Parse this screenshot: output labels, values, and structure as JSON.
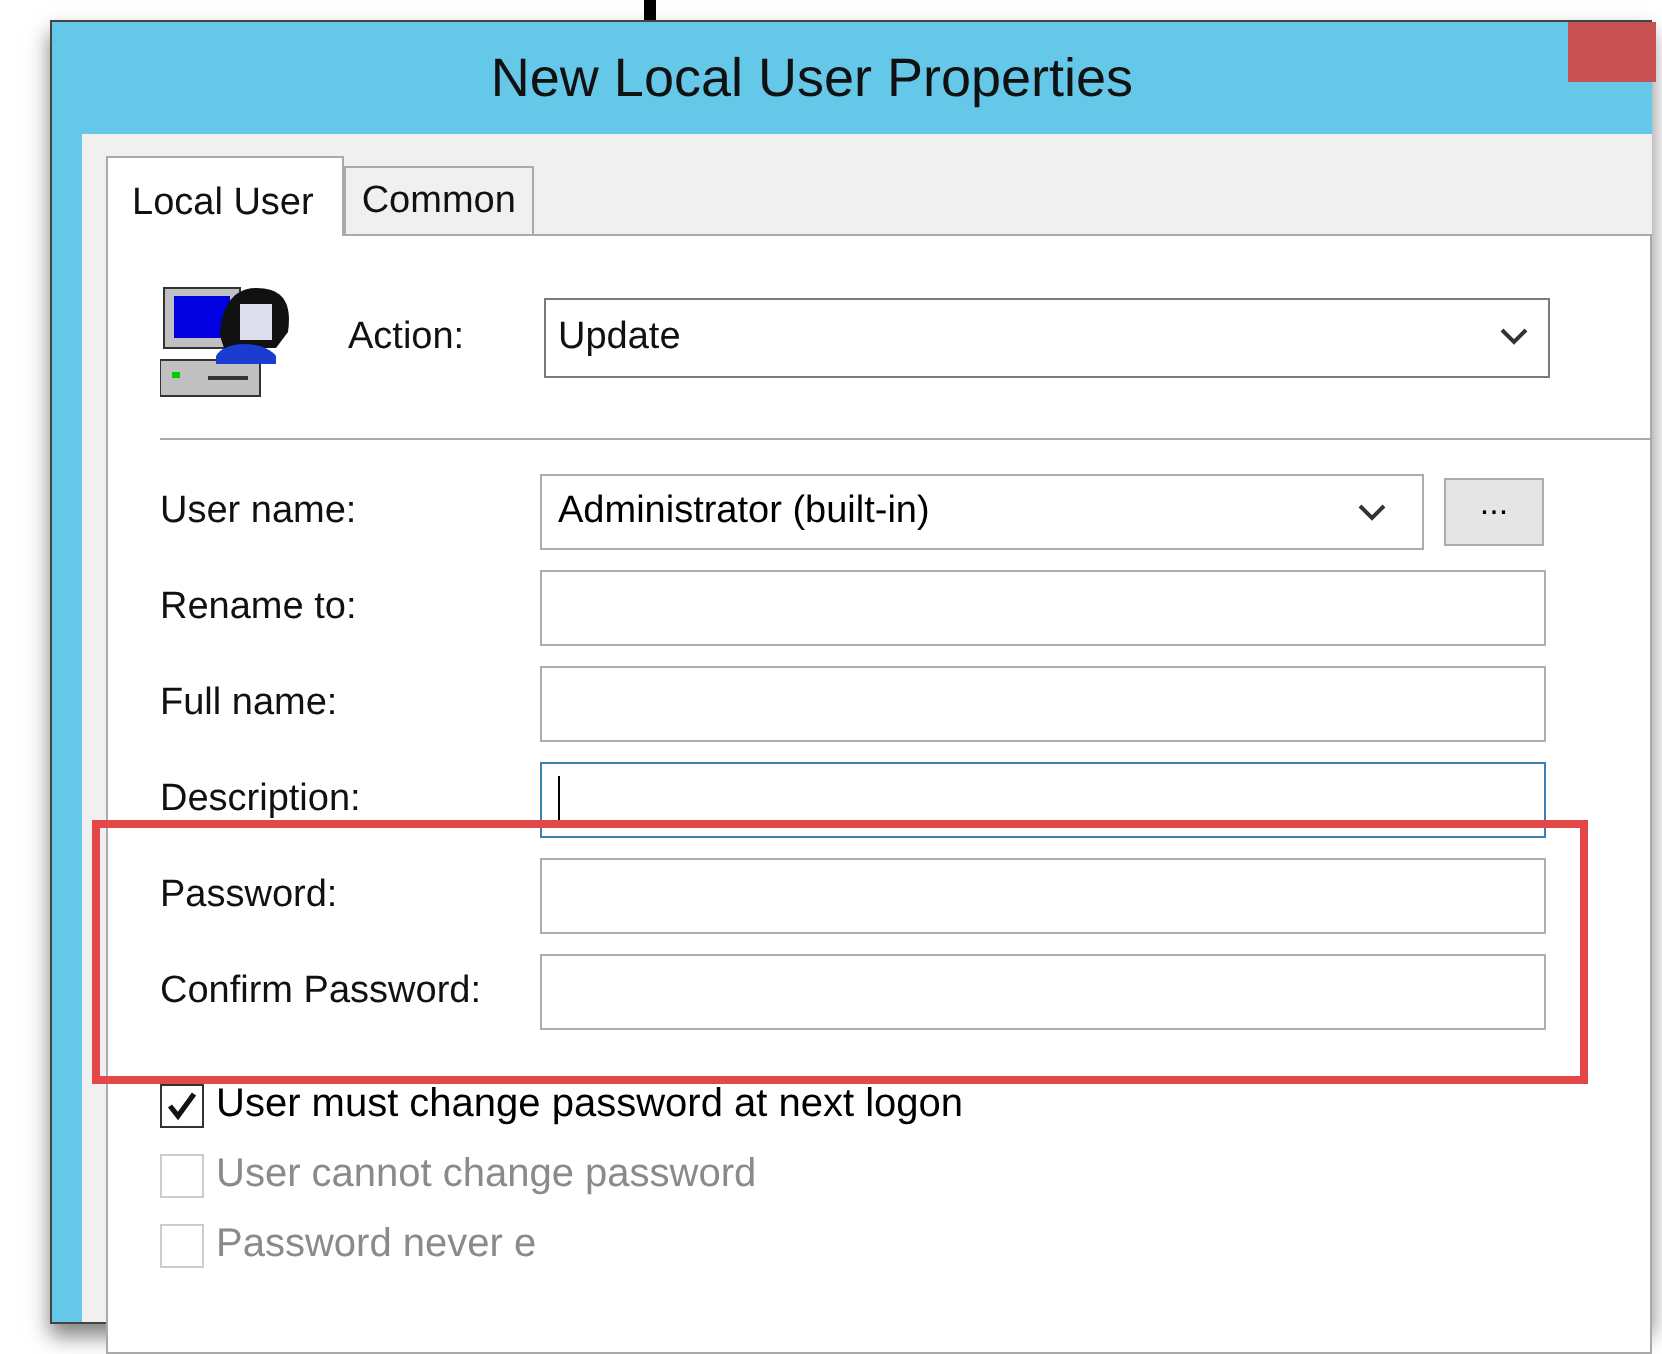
{
  "window": {
    "title": "New Local User Properties"
  },
  "tabs": [
    {
      "label": "Local User",
      "selected": true
    },
    {
      "label": "Common",
      "selected": false
    }
  ],
  "action": {
    "label": "Action:",
    "value": "Update"
  },
  "fields": [
    {
      "kind": "dropdown",
      "label": "User name:",
      "value": "Administrator (built-in)",
      "button": "..."
    },
    {
      "kind": "text",
      "label": "Rename to:",
      "focused": false
    },
    {
      "kind": "text",
      "label": "Full name:",
      "focused": false
    },
    {
      "kind": "text",
      "label": "Description:",
      "focused": true
    },
    {
      "kind": "text",
      "label": "Password:",
      "focused": false
    },
    {
      "kind": "text",
      "label": "Confirm Password:",
      "focused": false
    }
  ],
  "checkboxes": [
    {
      "label": "User must change password at next logon",
      "checked": true,
      "disabled": false
    },
    {
      "label": "User cannot change password",
      "checked": false,
      "disabled": true
    },
    {
      "label": "Password never e",
      "checked": false,
      "disabled": true
    }
  ]
}
